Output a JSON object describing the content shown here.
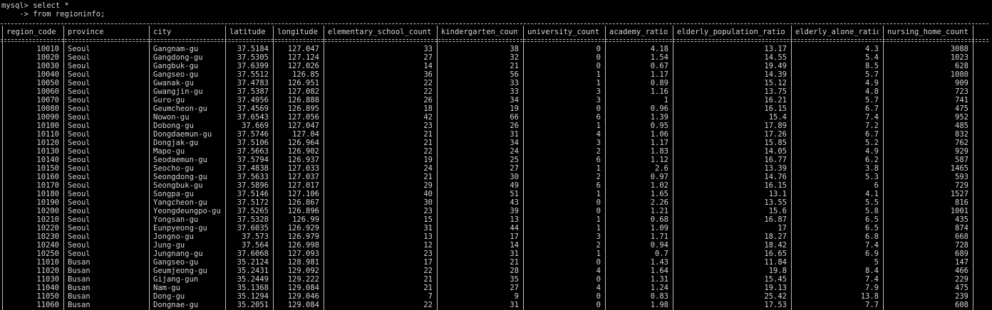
{
  "terminal": {
    "prompt_line": "mysql> select *",
    "continuation_line": "    -> from regioninfo;"
  },
  "columns": [
    {
      "key": "region_code",
      "label": "region_code",
      "align": "r"
    },
    {
      "key": "province",
      "label": "province",
      "align": "l"
    },
    {
      "key": "city",
      "label": "city",
      "align": "l"
    },
    {
      "key": "latitude",
      "label": "latitude",
      "align": "r"
    },
    {
      "key": "longitude",
      "label": "longitude",
      "align": "r"
    },
    {
      "key": "elementary_school_count",
      "label": "elementary_school_count",
      "align": "r"
    },
    {
      "key": "kindergarten_count",
      "label": "kindergarten_count",
      "align": "r"
    },
    {
      "key": "university_count",
      "label": "university_count",
      "align": "r"
    },
    {
      "key": "academy_ratio",
      "label": "academy_ratio",
      "align": "r"
    },
    {
      "key": "elderly_population_ratio",
      "label": "elderly_population_ratio",
      "align": "r"
    },
    {
      "key": "elderly_alone_ratio",
      "label": "elderly_alone_ratio",
      "align": "r"
    },
    {
      "key": "nursing_home_count",
      "label": "nursing_home_count",
      "align": "r"
    }
  ],
  "rows": [
    [
      "10010",
      "Seoul",
      "Gangnam-gu",
      "37.5184",
      "127.047",
      "33",
      "38",
      "0",
      "4.18",
      "13.17",
      "4.3",
      "3088"
    ],
    [
      "10020",
      "Seoul",
      "Gangdong-gu",
      "37.5305",
      "127.124",
      "27",
      "32",
      "0",
      "1.54",
      "14.55",
      "5.4",
      "1023"
    ],
    [
      "10030",
      "Seoul",
      "Gangbuk-gu",
      "37.6399",
      "127.026",
      "14",
      "21",
      "0",
      "0.67",
      "19.49",
      "8.5",
      "628"
    ],
    [
      "10040",
      "Seoul",
      "Gangseo-gu",
      "37.5512",
      "126.85",
      "36",
      "56",
      "1",
      "1.17",
      "14.39",
      "5.7",
      "1080"
    ],
    [
      "10050",
      "Seoul",
      "Gwanak-gu",
      "37.4783",
      "126.951",
      "22",
      "33",
      "1",
      "0.89",
      "15.12",
      "4.9",
      "909"
    ],
    [
      "10060",
      "Seoul",
      "Gwangjin-gu",
      "37.5387",
      "127.082",
      "22",
      "33",
      "3",
      "1.16",
      "13.75",
      "4.8",
      "723"
    ],
    [
      "10070",
      "Seoul",
      "Guro-gu",
      "37.4956",
      "126.888",
      "26",
      "34",
      "3",
      "1",
      "16.21",
      "5.7",
      "741"
    ],
    [
      "10080",
      "Seoul",
      "Geumcheon-gu",
      "37.4569",
      "126.895",
      "18",
      "19",
      "0",
      "0.96",
      "16.15",
      "6.7",
      "475"
    ],
    [
      "10090",
      "Seoul",
      "Nowon-gu",
      "37.6543",
      "127.056",
      "42",
      "66",
      "6",
      "1.39",
      "15.4",
      "7.4",
      "952"
    ],
    [
      "10100",
      "Seoul",
      "Dobong-gu",
      "37.669",
      "127.047",
      "23",
      "26",
      "1",
      "0.95",
      "17.89",
      "7.2",
      "485"
    ],
    [
      "10110",
      "Seoul",
      "Dongdaemun-gu",
      "37.5746",
      "127.04",
      "21",
      "31",
      "4",
      "1.06",
      "17.26",
      "6.7",
      "832"
    ],
    [
      "10120",
      "Seoul",
      "Dongjak-gu",
      "37.5106",
      "126.964",
      "21",
      "34",
      "3",
      "1.17",
      "15.85",
      "5.2",
      "762"
    ],
    [
      "10130",
      "Seoul",
      "Mapo-gu",
      "37.5663",
      "126.902",
      "22",
      "24",
      "2",
      "1.83",
      "14.05",
      "4.9",
      "929"
    ],
    [
      "10140",
      "Seoul",
      "Seodaemun-gu",
      "37.5794",
      "126.937",
      "19",
      "25",
      "6",
      "1.12",
      "16.77",
      "6.2",
      "587"
    ],
    [
      "10150",
      "Seoul",
      "Seocho-gu",
      "37.4838",
      "127.033",
      "24",
      "27",
      "1",
      "2.6",
      "13.39",
      "3.8",
      "1465"
    ],
    [
      "10160",
      "Seoul",
      "Seongdong-gu",
      "37.5633",
      "127.037",
      "21",
      "30",
      "2",
      "0.97",
      "14.76",
      "5.3",
      "593"
    ],
    [
      "10170",
      "Seoul",
      "Seongbuk-gu",
      "37.5896",
      "127.017",
      "29",
      "49",
      "6",
      "1.02",
      "16.15",
      "6",
      "729"
    ],
    [
      "10180",
      "Seoul",
      "Songpa-gu",
      "37.5146",
      "127.106",
      "40",
      "51",
      "1",
      "1.65",
      "13.1",
      "4.1",
      "1527"
    ],
    [
      "10190",
      "Seoul",
      "Yangcheon-gu",
      "37.5172",
      "126.867",
      "30",
      "43",
      "0",
      "2.26",
      "13.55",
      "5.5",
      "816"
    ],
    [
      "10200",
      "Seoul",
      "Yeongdeungpo-gu",
      "37.5265",
      "126.896",
      "23",
      "39",
      "0",
      "1.21",
      "15.6",
      "5.8",
      "1001"
    ],
    [
      "10210",
      "Seoul",
      "Yongsan-gu",
      "37.5328",
      "126.99",
      "15",
      "13",
      "1",
      "0.68",
      "16.87",
      "6.5",
      "435"
    ],
    [
      "10220",
      "Seoul",
      "Eunpyeong-gu",
      "37.6035",
      "126.929",
      "31",
      "44",
      "1",
      "1.09",
      "17",
      "6.5",
      "874"
    ],
    [
      "10230",
      "Seoul",
      "Jongno-gu",
      "37.573",
      "126.979",
      "13",
      "17",
      "3",
      "1.71",
      "18.27",
      "6.8",
      "668"
    ],
    [
      "10240",
      "Seoul",
      "Jung-gu",
      "37.564",
      "126.998",
      "12",
      "14",
      "2",
      "0.94",
      "18.42",
      "7.4",
      "728"
    ],
    [
      "10250",
      "Seoul",
      "Jungnang-gu",
      "37.6068",
      "127.093",
      "23",
      "31",
      "1",
      "0.7",
      "16.65",
      "6.9",
      "689"
    ],
    [
      "11010",
      "Busan",
      "Gangseo-gu",
      "35.2124",
      "128.981",
      "17",
      "21",
      "0",
      "1.43",
      "11.84",
      "5",
      "147"
    ],
    [
      "11020",
      "Busan",
      "Geumjeong-gu",
      "35.2431",
      "129.092",
      "22",
      "28",
      "4",
      "1.64",
      "19.8",
      "8.4",
      "466"
    ],
    [
      "11030",
      "Busan",
      "Gijang-gun",
      "35.2449",
      "129.222",
      "21",
      "35",
      "0",
      "1.31",
      "15.45",
      "7.4",
      "229"
    ],
    [
      "11040",
      "Busan",
      "Nam-gu",
      "35.1368",
      "129.084",
      "21",
      "27",
      "4",
      "1.24",
      "19.13",
      "7.9",
      "475"
    ],
    [
      "11050",
      "Busan",
      "Dong-gu",
      "35.1294",
      "129.046",
      "7",
      "9",
      "0",
      "0.83",
      "25.42",
      "13.8",
      "239"
    ],
    [
      "11060",
      "Busan",
      "Dongnae-gu",
      "35.2051",
      "129.084",
      "22",
      "31",
      "0",
      "1.98",
      "17.53",
      "7.7",
      "608"
    ]
  ]
}
